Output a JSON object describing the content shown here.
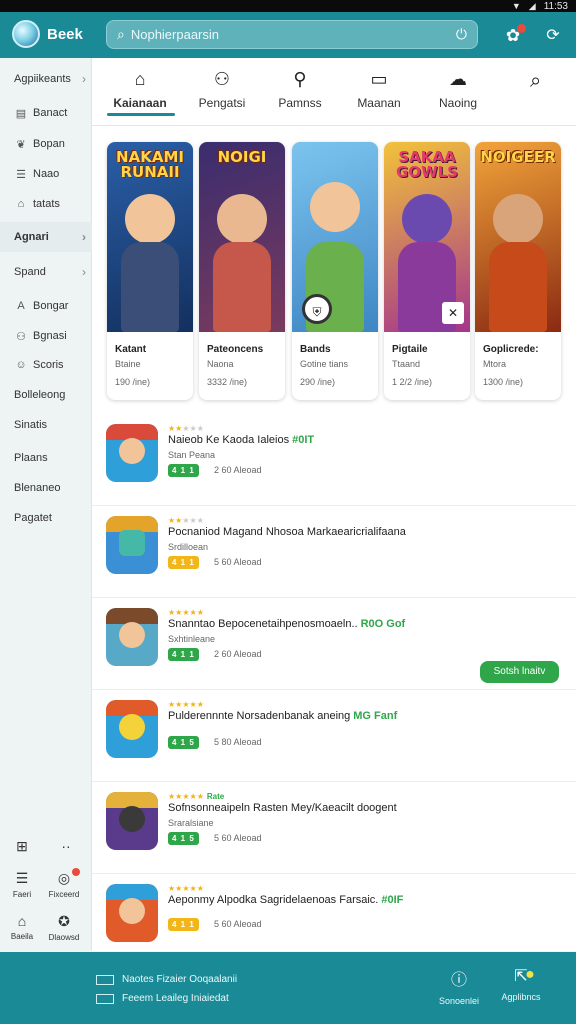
{
  "status_bar": {
    "time": "11:53",
    "icons": [
      "signal-icon",
      "wifi-icon",
      "battery-icon"
    ]
  },
  "app_bar": {
    "title": "Beek",
    "search_placeholder": "Nophierpaarsin",
    "icons": [
      "logo-icon",
      "search-icon",
      "mic-icon",
      "notification-icon",
      "refresh-icon"
    ],
    "accent": "#1a8b96"
  },
  "sidebar": {
    "items": [
      {
        "label": "Agpiikeants",
        "icon": "",
        "chevron": true
      },
      {
        "label": "Banact",
        "icon": "doc-icon",
        "chevron": false
      },
      {
        "label": "Bopan",
        "icon": "leaf-icon",
        "chevron": false
      },
      {
        "label": "Naao",
        "icon": "list-icon",
        "chevron": false
      },
      {
        "label": "tatats",
        "icon": "home-icon",
        "chevron": false
      },
      {
        "label": "Agnari",
        "icon": "",
        "chevron": true
      },
      {
        "label": "Spand",
        "icon": "",
        "chevron": true
      },
      {
        "label": "Bongar",
        "icon": "a-icon",
        "chevron": false
      },
      {
        "label": "Bgnasi",
        "icon": "people-icon",
        "chevron": false
      },
      {
        "label": "Scoris",
        "icon": "user-icon",
        "chevron": false
      },
      {
        "label": "Bolleleong",
        "icon": "",
        "chevron": false
      },
      {
        "label": "Sinatis",
        "icon": "",
        "chevron": false
      },
      {
        "label": "Plaans",
        "icon": "",
        "chevron": false
      },
      {
        "label": "Blenaneo",
        "icon": "",
        "chevron": false
      },
      {
        "label": "Pagatet",
        "icon": "",
        "chevron": false
      }
    ],
    "bottom": [
      {
        "label": "Faeri",
        "icon": "list-icon"
      },
      {
        "label": "Fixceerd",
        "icon": "gamepad-icon"
      },
      {
        "label": "Baeila",
        "icon": "home-icon"
      },
      {
        "label": "Dlaowsd",
        "icon": "controller-icon"
      }
    ]
  },
  "tabs": [
    {
      "label": "Kaianaan",
      "icon": "home-icon",
      "active": true
    },
    {
      "label": "Pengatsi",
      "icon": "people-icon",
      "active": false
    },
    {
      "label": "Pamnss",
      "icon": "pin-icon",
      "active": false
    },
    {
      "label": "Maanan",
      "icon": "message-icon",
      "active": false
    },
    {
      "label": "Naoing",
      "icon": "puzzle-icon",
      "active": false
    }
  ],
  "featured": [
    {
      "art_title": "NAKAMI RUNAII",
      "name": "Katant",
      "subtitle": "Btaine",
      "meta": "190 /ine)",
      "colors": [
        "#2a5fa8",
        "#e5a03a"
      ],
      "badge": ""
    },
    {
      "art_title": "NOIGI",
      "name": "Pateoncens",
      "subtitle": "Naona",
      "meta": "3332 /ine)",
      "colors": [
        "#3a2d6e",
        "#c6584b"
      ],
      "badge": ""
    },
    {
      "art_title": "",
      "name": "Bands",
      "subtitle": "Gotine tians",
      "meta": "290 /ine)",
      "colors": [
        "#4d9ad6",
        "#6ab04c"
      ],
      "badge": "shield-icon"
    },
    {
      "art_title": "SAKAA GOWLS",
      "name": "Pigtaile",
      "subtitle": "Ttaand",
      "meta": "1 2/2 /ine)",
      "colors": [
        "#a4358c",
        "#f2c23a"
      ],
      "badge": "x-icon"
    },
    {
      "art_title": "NOIGEER",
      "name": "Goplicrede:",
      "subtitle": "Mtora",
      "meta": "1300 /ine)",
      "colors": [
        "#c74a1b",
        "#f2a43a"
      ],
      "badge": ""
    }
  ],
  "list": [
    {
      "stars": 2,
      "extra": "",
      "title": "Naieob Ke Kaoda Ialeios",
      "tag": "#0IT",
      "subtitle": "Stan Peana",
      "rating": "4 1 1",
      "rating_color": "#2fa64a",
      "downloads": "2 60 Aleoad",
      "action": "",
      "icon_colors": [
        "#d94a3a",
        "#2e9fd8"
      ]
    },
    {
      "stars": 2,
      "extra": "",
      "title": "Pocnaniod Magand Nhosoa Markaearicrialifaana",
      "tag": "",
      "subtitle": "Srdilloean",
      "rating": "4 1 1",
      "rating_color": "#f3b619",
      "downloads": "5 60 Aleoad",
      "action": "",
      "icon_colors": [
        "#e4a42a",
        "#3b8fd4"
      ]
    },
    {
      "stars": 5,
      "extra": "",
      "title": "Snanntao Bepocenetaihpenosmoaeln..",
      "tag": "R0O Gof",
      "subtitle": "Sxhtinleane",
      "rating": "4 1 1",
      "rating_color": "#2fa64a",
      "downloads": "2 60 Aleoad",
      "action": "Sotsh lnaitv",
      "icon_colors": [
        "#7a4a2a",
        "#58a8c7"
      ]
    },
    {
      "stars": 5,
      "extra": "",
      "title": "Pulderennnte Norsadenbanak aneing",
      "tag": "MG Fanf",
      "subtitle": "",
      "rating": "4 1 5",
      "rating_color": "#2fa64a",
      "downloads": "5 80 Aleoad",
      "action": "",
      "icon_colors": [
        "#e05a2a",
        "#2e9fd8"
      ]
    },
    {
      "stars": 5,
      "extra": "Rate",
      "title": "Sofnsonneaipeln Rasten Mey/Kaeacilt doogent",
      "tag": "",
      "subtitle": "Sraralsiane",
      "rating": "4 1 5",
      "rating_color": "#2fa64a",
      "downloads": "5 60 Aleoad",
      "action": "",
      "icon_colors": [
        "#5a3a8a",
        "#e4b23a"
      ]
    },
    {
      "stars": 5,
      "extra": "",
      "title": "Aeponmy Alpodka Sagridelaenoas Farsaic.",
      "tag": "#0IF",
      "subtitle": "",
      "rating": "4 1 1",
      "rating_color": "#f3b619",
      "downloads": "5 60 Aleoad",
      "action": "",
      "icon_colors": [
        "#2e9fd8",
        "#e05a2a"
      ]
    }
  ],
  "footer": {
    "rows": [
      "Naotes Fizaier Ooqaalanii",
      "Feeem Leaileg Iniaiedat"
    ],
    "buttons": [
      {
        "label": "Sonoenlei",
        "icon": "info-icon"
      },
      {
        "label": "Agplibncs",
        "icon": "share-icon"
      },
      {
        "label": "",
        "icon": "globe-icon"
      }
    ]
  }
}
